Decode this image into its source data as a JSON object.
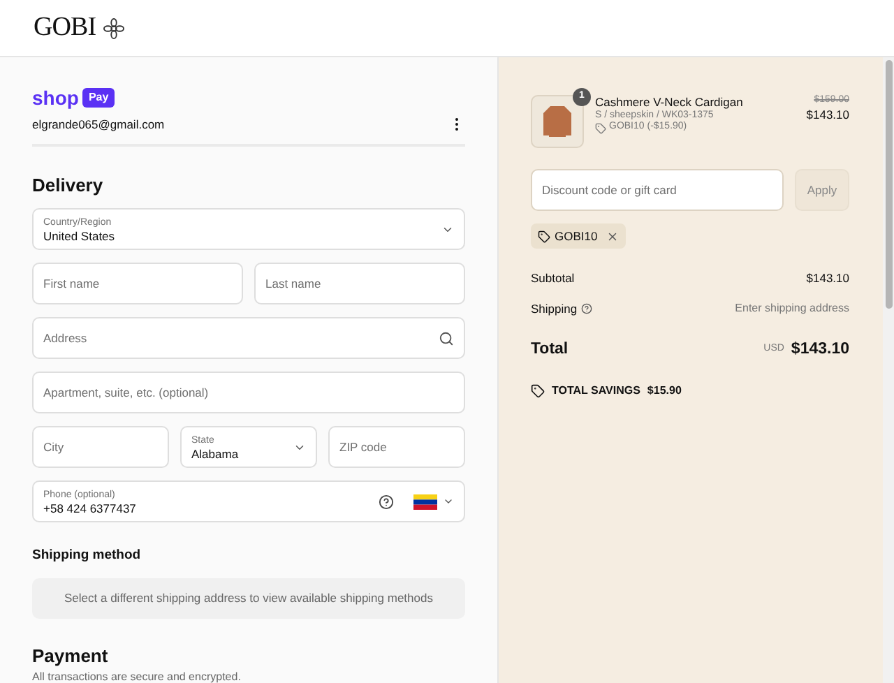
{
  "header": {
    "brand": "GOBI"
  },
  "account": {
    "shop_word": "shop",
    "pay_badge": "Pay",
    "email": "elgrande065@gmail.com"
  },
  "delivery": {
    "title": "Delivery",
    "field_rows": [
      [
        {
          "kind": "select",
          "label": "Country/Region",
          "value": "United States"
        }
      ],
      [
        {
          "kind": "text",
          "placeholder": "First name"
        },
        {
          "kind": "text",
          "placeholder": "Last name"
        }
      ],
      [
        {
          "kind": "search",
          "placeholder": "Address"
        }
      ],
      [
        {
          "kind": "text",
          "placeholder": "Apartment, suite, etc. (optional)"
        }
      ],
      [
        {
          "kind": "text",
          "placeholder": "City"
        },
        {
          "kind": "select",
          "label": "State",
          "value": "Alabama"
        },
        {
          "kind": "text",
          "placeholder": "ZIP code"
        }
      ],
      [
        {
          "kind": "phone",
          "label": "Phone (optional)",
          "value": "+58 424 6377437"
        }
      ]
    ]
  },
  "shipping_method": {
    "title": "Shipping method",
    "message": "Select a different shipping address to view available shipping methods"
  },
  "payment": {
    "title": "Payment",
    "subtitle": "All transactions are secure and encrypted."
  },
  "summary": {
    "item": {
      "quantity": "1",
      "name": "Cashmere V-Neck Cardigan",
      "variant": "S / sheepskin / WK03-1375",
      "discount": "GOBI10 (-$15.90)",
      "original_price": "$159.00",
      "price": "$143.10"
    },
    "discount_field": {
      "placeholder": "Discount code or gift card"
    },
    "apply_button": "Apply",
    "applied_code": "GOBI10",
    "lines": [
      {
        "label": "Subtotal",
        "value": "$143.10",
        "info": false
      },
      {
        "label": "Shipping",
        "value": "Enter shipping address",
        "info": true
      }
    ],
    "total": {
      "label": "Total",
      "currency": "USD",
      "value": "$143.10"
    },
    "savings": {
      "label": "TOTAL SAVINGS",
      "value": "$15.90"
    }
  }
}
